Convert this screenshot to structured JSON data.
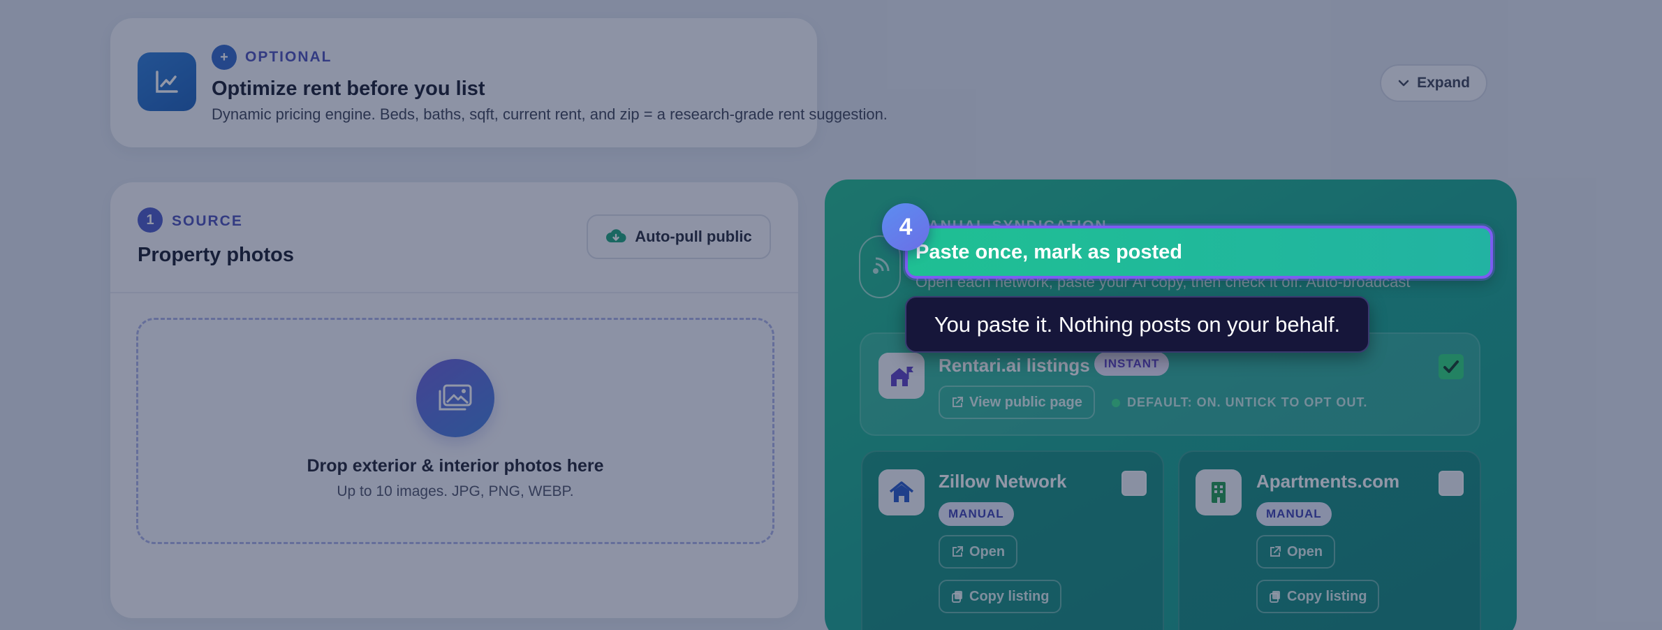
{
  "optional": {
    "tag": "OPTIONAL",
    "title": "Optimize rent before you list",
    "description": "Dynamic pricing engine. Beds, baths, sqft, current rent, and zip = a research-grade rent suggestion.",
    "expand_label": "Expand"
  },
  "source": {
    "step": "1",
    "tag": "SOURCE",
    "title": "Property photos",
    "autopull_label": "Auto-pull public",
    "drop_title": "Drop exterior & interior photos here",
    "drop_sub": "Up to 10 images. JPG, PNG, WEBP."
  },
  "syndication": {
    "tag": "MANUAL SYNDICATION",
    "title": "Paste once, mark as posted",
    "description": "Open each network, paste your AI copy, then check it off. Auto-broadcast",
    "rentari": {
      "name": "Rentari.ai listings",
      "badge": "INSTANT",
      "view_label": "View public page",
      "default_note": "DEFAULT: ON. UNTICK TO OPT OUT.",
      "checked": true
    },
    "networks": [
      {
        "name": "Zillow Network",
        "badge": "MANUAL",
        "open_label": "Open",
        "copy_label": "Copy listing",
        "checked": false
      },
      {
        "name": "Apartments.com",
        "badge": "MANUAL",
        "open_label": "Open",
        "copy_label": "Copy listing",
        "checked": false
      }
    ]
  },
  "tour": {
    "step": "4",
    "tooltip": "You paste it. Nothing posts on your behalf."
  },
  "colors": {
    "accent": "#7c5cf2",
    "synd_green": "#1ebd8f",
    "overlay": "#1c2648",
    "tooltip_bg": "#16163a"
  }
}
